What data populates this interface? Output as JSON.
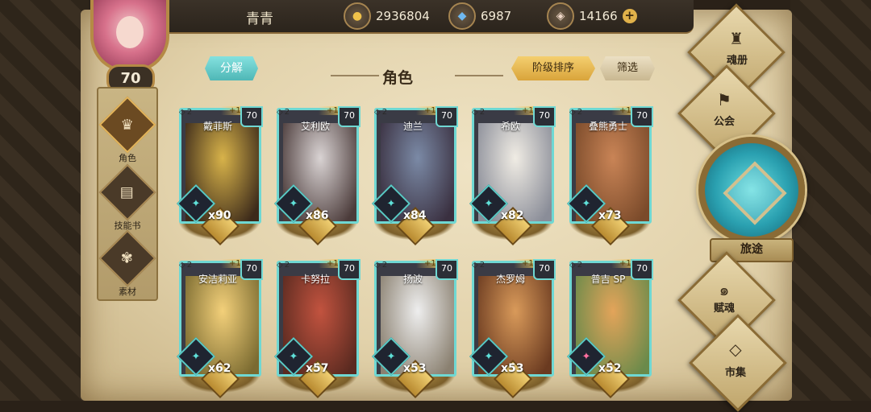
{
  "player": {
    "name": "青青",
    "level": "70"
  },
  "resources": {
    "gold": "2936804",
    "crystal": "6987",
    "gem": "14166",
    "add": "+"
  },
  "left_menu": [
    {
      "label": "角色",
      "icon": "helmet-icon"
    },
    {
      "label": "技能书",
      "icon": "book-icon"
    },
    {
      "label": "素材",
      "icon": "material-icon"
    }
  ],
  "header": {
    "decompose": "分解",
    "title": "角色",
    "sort": "阶级排序",
    "filter": "筛选"
  },
  "cards": [
    {
      "name": "戴菲斯",
      "stars": "2",
      "bonus": "+15",
      "level": "70",
      "count": "x90",
      "element": "cyan",
      "colors": [
        "#d8b34a",
        "#3c2a1a"
      ]
    },
    {
      "name": "艾利欧",
      "stars": "2",
      "bonus": "+15",
      "level": "70",
      "count": "x86",
      "element": "cyan",
      "colors": [
        "#d9d3d3",
        "#4b3b3a"
      ]
    },
    {
      "name": "迪兰",
      "stars": "2",
      "bonus": "+15",
      "level": "70",
      "count": "x84",
      "element": "cyan",
      "colors": [
        "#7b8aa6",
        "#3a3040"
      ]
    },
    {
      "name": "希欧",
      "stars": "2",
      "bonus": "+15",
      "level": "70",
      "count": "x82",
      "element": "cyan",
      "colors": [
        "#f0ece4",
        "#8a8d98"
      ]
    },
    {
      "name": "叠熊勇士",
      "stars": "2",
      "bonus": "+15",
      "level": "70",
      "count": "x73",
      "element": "cyan",
      "colors": [
        "#c98456",
        "#7a4a2a"
      ]
    },
    {
      "name": "安洁莉亚",
      "stars": "2",
      "bonus": "+15",
      "level": "70",
      "count": "x62",
      "element": "cyan",
      "colors": [
        "#f3d07a",
        "#7a6a30"
      ]
    },
    {
      "name": "卡努拉",
      "stars": "2",
      "bonus": "+15",
      "level": "70",
      "count": "x57",
      "element": "cyan",
      "colors": [
        "#c2533f",
        "#5a2a20"
      ]
    },
    {
      "name": "扬波",
      "stars": "2",
      "bonus": "+15",
      "level": "70",
      "count": "x53",
      "element": "cyan",
      "colors": [
        "#eeeeee",
        "#8a8070"
      ]
    },
    {
      "name": "杰罗姆",
      "stars": "2",
      "bonus": "+15",
      "level": "70",
      "count": "x53",
      "element": "cyan",
      "colors": [
        "#d99a5a",
        "#6a3a20"
      ]
    },
    {
      "name": "普吉 SP",
      "stars": "2",
      "bonus": "+15",
      "level": "70",
      "count": "x52",
      "element": "pink",
      "colors": [
        "#e3a45a",
        "#6a8a4a"
      ]
    }
  ],
  "right_menu": {
    "hunlu": "魂册",
    "guild": "公会",
    "journey": "旅途",
    "fuhun": "赋魂",
    "market": "市集"
  }
}
